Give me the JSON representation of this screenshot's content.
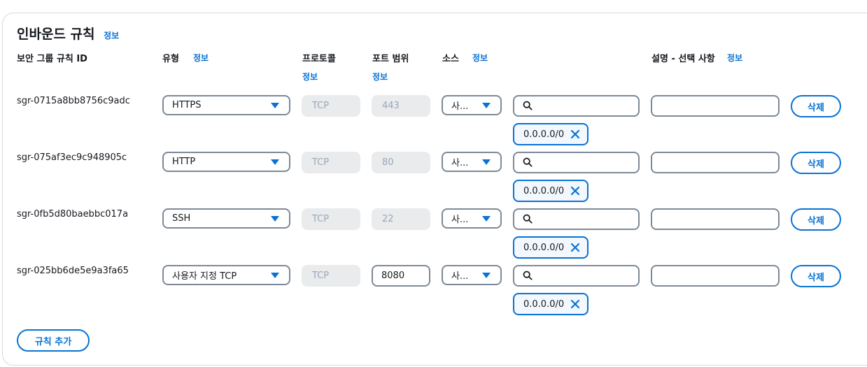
{
  "section": {
    "title": "인바운드 규칙",
    "info": "정보"
  },
  "columns": {
    "rule_id": "보안 그룹 규칙 ID",
    "type": "유형",
    "type_info": "정보",
    "protocol": "프로토콜",
    "protocol_info": "정보",
    "port_range": "포트 범위",
    "port_range_info": "정보",
    "source": "소스",
    "source_info": "정보",
    "description": "설명 - 선택 사항",
    "description_info": "정보"
  },
  "rules": [
    {
      "id": "sgr-0715a8bb8756c9adc",
      "type": "HTTPS",
      "protocol": "TCP",
      "port": "443",
      "port_editable": false,
      "source_type": "사...",
      "cidr": "0.0.0.0/0",
      "description": "",
      "delete_label": "삭제"
    },
    {
      "id": "sgr-075af3ec9c948905c",
      "type": "HTTP",
      "protocol": "TCP",
      "port": "80",
      "port_editable": false,
      "source_type": "사...",
      "cidr": "0.0.0.0/0",
      "description": "",
      "delete_label": "삭제"
    },
    {
      "id": "sgr-0fb5d80baebbc017a",
      "type": "SSH",
      "protocol": "TCP",
      "port": "22",
      "port_editable": false,
      "source_type": "사...",
      "cidr": "0.0.0.0/0",
      "description": "",
      "delete_label": "삭제"
    },
    {
      "id": "sgr-025bb6de5e9a3fa65",
      "type": "사용자 지정 TCP",
      "protocol": "TCP",
      "port": "8080",
      "port_editable": true,
      "source_type": "사...",
      "cidr": "0.0.0.0/0",
      "description": "",
      "delete_label": "삭제"
    }
  ],
  "add_rule_label": "규칙 추가",
  "colors": {
    "accent": "#0972d3",
    "border": "#7d8998",
    "disabled_bg": "#e9ebed",
    "disabled_text": "#9ba7b6"
  }
}
